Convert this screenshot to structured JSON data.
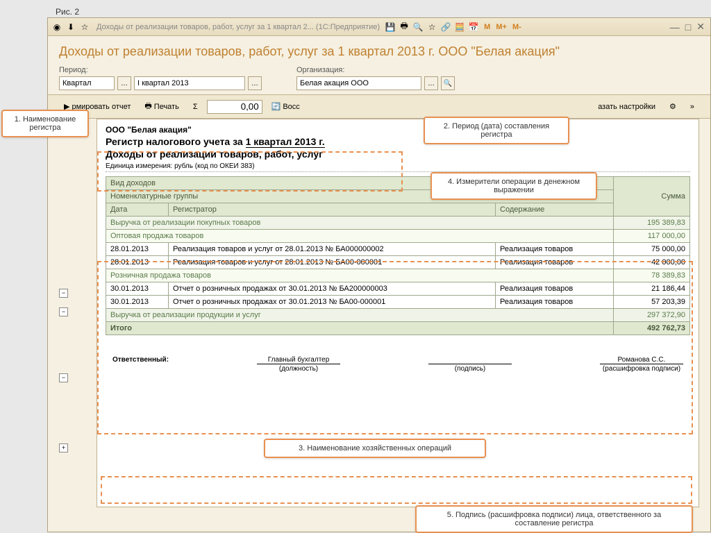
{
  "fig_label": "Рис. 2",
  "window_title": "Доходы от реализации товаров, работ, услуг за 1 квартал 2...   (1С:Предприятие)",
  "page_title": "Доходы от реализации товаров, работ, услуг за 1 квартал 2013 г. ООО \"Белая акация\"",
  "filters": {
    "period_label": "Период:",
    "period_type": "Квартал",
    "period_value": "I квартал 2013",
    "org_label": "Организация:",
    "org_value": "Белая акация ООО"
  },
  "toolbar": {
    "form_report": "рмировать отчет",
    "print": "Печать",
    "sigma": "Σ",
    "num_value": "0,00",
    "restore": "Восс",
    "show_settings": "азать настройки"
  },
  "report": {
    "org": "ООО \"Белая акация\"",
    "reg_prefix": "Регистр налогового учета за ",
    "reg_period": "1 квартал 2013 г.",
    "subtitle": "Доходы от реализации товаров, работ, услуг",
    "unit": "Единица измерения:    рубль (код по ОКЕИ 383)",
    "headers": {
      "income_type": "Вид доходов",
      "nom_groups": "Номенклатурные группы",
      "date": "Дата",
      "registrator": "Регистратор",
      "content": "Содержание",
      "sum": "Сумма"
    },
    "rows": [
      {
        "type": "lvl1",
        "span": "Выручка от реализации покупных товаров",
        "sum": "195 389,83"
      },
      {
        "type": "lvl2",
        "span": "Оптовая продажа товаров",
        "sum": "117 000,00"
      },
      {
        "type": "data",
        "date": "28.01.2013",
        "reg": "Реализация товаров и услуг от 28.01.2013 № БА000000002",
        "content": "Реализация товаров",
        "sum": "75 000,00"
      },
      {
        "type": "data",
        "date": "28.01.2013",
        "reg": "Реализация товаров и услуг от 28.01.2013 № БА00-000001",
        "content": "Реализация товаров",
        "sum": "42 000,00"
      },
      {
        "type": "lvl2",
        "span": "Розничная продажа товаров",
        "sum": "78 389,83"
      },
      {
        "type": "data",
        "date": "30.01.2013",
        "reg": "Отчет о розничных продажах от 30.01.2013 № БА200000003",
        "content": "Реализация товаров",
        "sum": "21 186,44"
      },
      {
        "type": "data",
        "date": "30.01.2013",
        "reg": "Отчет о розничных продажах от 30.01.2013 № БА00-000001",
        "content": "Реализация товаров",
        "sum": "57 203,39"
      },
      {
        "type": "lvl1",
        "span": "Выручка от реализации продукции и услуг",
        "sum": "297 372,90"
      },
      {
        "type": "total",
        "span": "Итого",
        "sum": "492 762,73"
      }
    ],
    "signature": {
      "resp_label": "Ответственный:",
      "position_value": "Главный бухгалтер",
      "position_caption": "(должность)",
      "sign_caption": "(подпись)",
      "name_value": "Романова С.С.",
      "name_caption": "(расшифровка подписи)"
    }
  },
  "callouts": {
    "c1": "1. Наименование регистра",
    "c2": "2. Период (дата) составления регистра",
    "c3": "3. Наименование хозяйственных операций",
    "c4": "4. Измерители операции в денежном выражении",
    "c5": "5. Подпись (расшифровка подписи) лица, ответственного за составление регистра"
  },
  "mem_buttons": {
    "m": "M",
    "mplus": "M+",
    "mminus": "M-"
  }
}
